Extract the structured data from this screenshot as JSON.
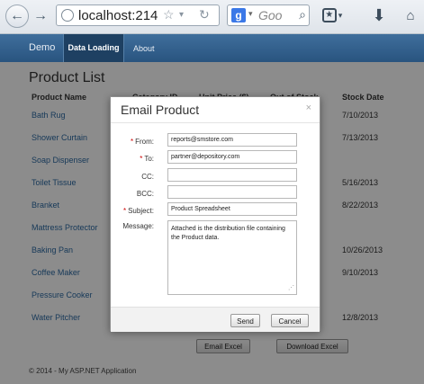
{
  "browser": {
    "url": "localhost:214",
    "search_placeholder": "Goo",
    "search_engine_letter": "g"
  },
  "navbar": {
    "brand": "Demo",
    "items": [
      {
        "label": "Data Loading",
        "active": true
      },
      {
        "label": "About",
        "active": false
      }
    ]
  },
  "page": {
    "title": "Product List",
    "columns": [
      "Product Name",
      "Category ID",
      "Unit Price ($)",
      "Out of Stock",
      "Stock Date"
    ],
    "products": [
      {
        "name": "Bath Rug",
        "stock_date": "7/10/2013"
      },
      {
        "name": "Shower Curtain",
        "stock_date": "7/13/2013"
      },
      {
        "name": "Soap Dispenser",
        "stock_date": ""
      },
      {
        "name": "Toilet Tissue",
        "stock_date": "5/16/2013"
      },
      {
        "name": "Branket",
        "stock_date": "8/22/2013"
      },
      {
        "name": "Mattress Protector",
        "stock_date": ""
      },
      {
        "name": "Baking Pan",
        "stock_date": "10/26/2013"
      },
      {
        "name": "Coffee Maker",
        "stock_date": "9/10/2013"
      },
      {
        "name": "Pressure Cooker",
        "stock_date": ""
      },
      {
        "name": "Water Pitcher",
        "stock_date": "12/8/2013"
      }
    ],
    "buttons": {
      "email_excel": "Email Excel",
      "download_excel": "Download Excel"
    },
    "footer": "© 2014 - My ASP.NET Application"
  },
  "dialog": {
    "title": "Email Product",
    "close_glyph": "×",
    "from_label": "From:",
    "from_value": "reports@smstore.com",
    "to_label": "To:",
    "to_value": "partner@depository.com",
    "cc_label": "CC:",
    "cc_value": "",
    "bcc_label": "BCC:",
    "bcc_value": "",
    "subject_label": "Subject:",
    "subject_value": "Product Spreadsheet",
    "message_label": "Message:",
    "message_value": "Attached is the distribution file containing the Product data.",
    "send_label": "Send",
    "cancel_label": "Cancel",
    "required_marker": "*"
  },
  "colors": {
    "navbar": "#29547f",
    "link": "#2d6aa3",
    "required": "#cc0000"
  }
}
